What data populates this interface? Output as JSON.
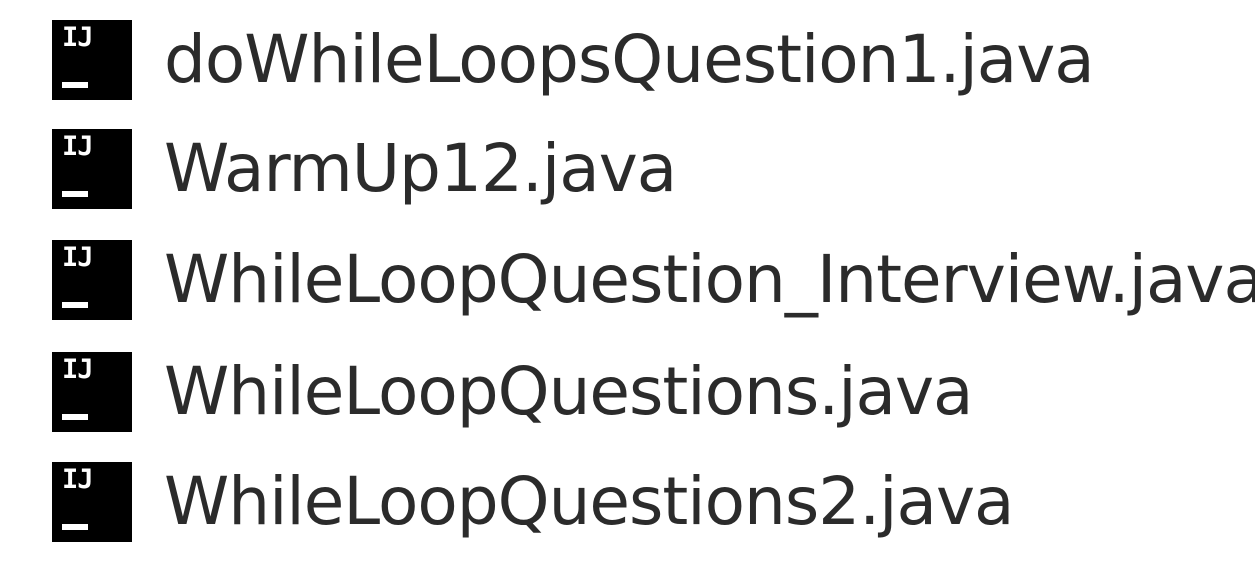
{
  "files": [
    {
      "name": "doWhileLoopsQuestion1.java",
      "icon": "intellij-idea-icon",
      "icon_text": "IJ"
    },
    {
      "name": "WarmUp12.java",
      "icon": "intellij-idea-icon",
      "icon_text": "IJ"
    },
    {
      "name": "WhileLoopQuestion_Interview.java",
      "icon": "intellij-idea-icon",
      "icon_text": "IJ"
    },
    {
      "name": "WhileLoopQuestions.java",
      "icon": "intellij-idea-icon",
      "icon_text": "IJ"
    },
    {
      "name": "WhileLoopQuestions2.java",
      "icon": "intellij-idea-icon",
      "icon_text": "IJ"
    }
  ]
}
